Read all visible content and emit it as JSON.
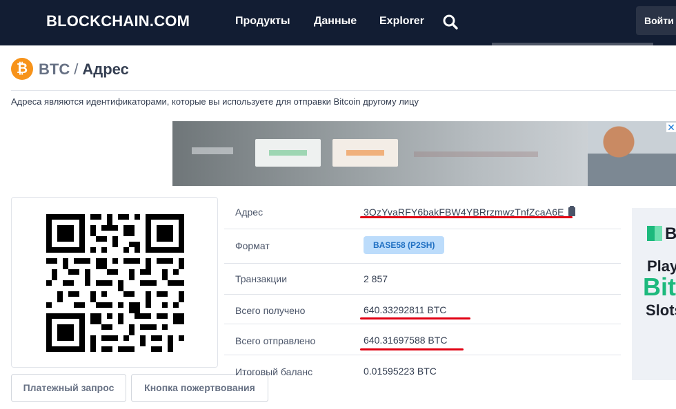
{
  "header": {
    "logo": "BLOCKCHAIN.COM",
    "nav": [
      "Продукты",
      "Данные",
      "Explorer"
    ],
    "search_icon": "search-icon",
    "login_label": "Войти"
  },
  "breadcrumb": {
    "coin_icon_glyph": "₿",
    "coin": "BTC",
    "separator": "/",
    "page": "Адрес"
  },
  "description": "Адреса являются идентификаторами, которые вы используете для отправки Bitcoin другому лицу",
  "address_info": {
    "rows": [
      {
        "label": "Адрес",
        "value": "3QzYvaRFY6bakFBW4YBRrzmwzTnfZcaA6E"
      },
      {
        "label": "Формат",
        "value": "BASE58 (P2SH)"
      },
      {
        "label": "Транзакции",
        "value": "2 857"
      },
      {
        "label": "Всего получено",
        "value": "640.33292811 BTC"
      },
      {
        "label": "Всего отправлено",
        "value": "640.31697588 BTC"
      },
      {
        "label": "Итоговый баланс",
        "value": "0.01595223 BTC"
      }
    ]
  },
  "buttons": {
    "payment_request": "Платежный запрос",
    "donation_button": "Кнопка пожертвования"
  },
  "side_ad": {
    "logo_text": "B",
    "line1": "Play",
    "line2": "Bit",
    "line3": "Slots"
  },
  "ad_close_glyph": "✕",
  "colors": {
    "header_bg": "#121d33",
    "bitcoin_orange": "#f7931a",
    "format_badge_bg": "#bcdcfb",
    "format_badge_text": "#1f6fc2",
    "annotation_red": "#e10012"
  }
}
